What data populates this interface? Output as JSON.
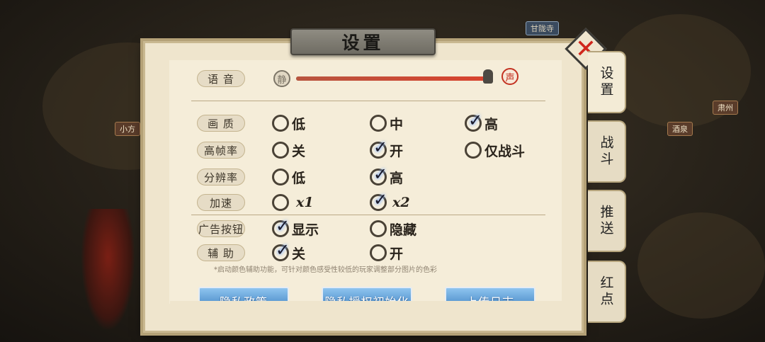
{
  "map": {
    "labels": [
      "甘陇寺",
      "小方",
      "肃州",
      "酒泉"
    ]
  },
  "title": "设置",
  "close_icon": "close-x-icon",
  "tabs": [
    {
      "label": "设置",
      "active": true
    },
    {
      "label": "战斗",
      "active": false
    },
    {
      "label": "推送",
      "active": false
    },
    {
      "label": "红点",
      "active": false
    }
  ],
  "volume": {
    "label": "语 音",
    "min_icon_text": "静",
    "max_icon_text": "声",
    "level": 0.98
  },
  "settings": {
    "quality": {
      "label": "画 质",
      "options": [
        "低",
        "中",
        "高"
      ],
      "selected": 2
    },
    "framerate": {
      "label": "高帧率",
      "options": [
        "关",
        "开",
        "仅战斗"
      ],
      "selected": 1
    },
    "resolution": {
      "label": "分辨率",
      "options": [
        "低",
        "高"
      ],
      "selected": 1
    },
    "speed": {
      "label": "加速",
      "options": [
        "x1",
        "x2"
      ],
      "selected": 1
    },
    "ad_button": {
      "label": "广告按钮",
      "options": [
        "显示",
        "隐藏"
      ],
      "selected": 0
    },
    "assist": {
      "label": "辅 助",
      "options": [
        "关",
        "开"
      ],
      "selected": 0
    }
  },
  "assist_note": "*启动颜色辅助功能，可针对颜色感受性较低的玩家调整部分图片的色彩",
  "buttons": [
    "隐私政策",
    "隐私授权初始化",
    "上传日志"
  ],
  "colors": {
    "accent_red": "#d0261c",
    "parchment": "#efe5cd",
    "button_blue": "#5a9ad3"
  }
}
